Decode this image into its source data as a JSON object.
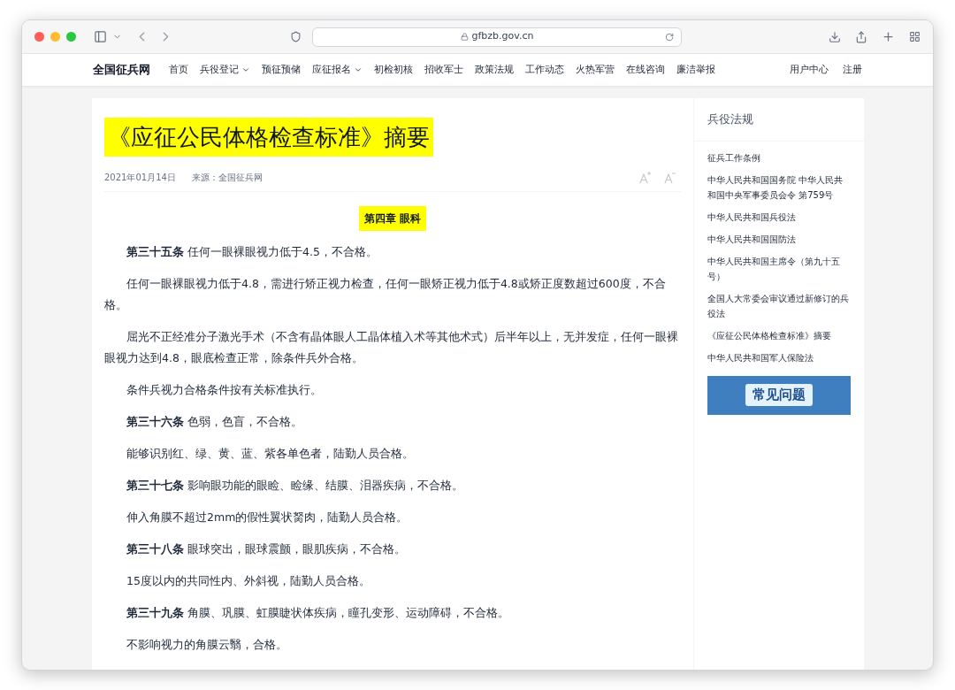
{
  "browser": {
    "url": "gfbzb.gov.cn"
  },
  "site": {
    "logo": "全国征兵网",
    "nav": [
      {
        "label": "首页",
        "dropdown": false
      },
      {
        "label": "兵役登记",
        "dropdown": true
      },
      {
        "label": "预征预储",
        "dropdown": false
      },
      {
        "label": "应征报名",
        "dropdown": true
      },
      {
        "label": "初检初核",
        "dropdown": false
      },
      {
        "label": "招收军士",
        "dropdown": false
      },
      {
        "label": "政策法规",
        "dropdown": false
      },
      {
        "label": "工作动态",
        "dropdown": false
      },
      {
        "label": "火热军营",
        "dropdown": false
      },
      {
        "label": "在线咨询",
        "dropdown": false
      },
      {
        "label": "廉洁举报",
        "dropdown": false
      }
    ],
    "user_links": [
      "用户中心",
      "注册"
    ]
  },
  "article": {
    "title": "《应征公民体格检查标准》摘要",
    "date": "2021年01月14日",
    "source": "来源：全国征兵网",
    "chapter": "第四章 眼科",
    "paragraphs": [
      "**第三十五条** 任何一眼裸眼视力低于4.5，不合格。",
      "任何一眼裸眼视力低于4.8，需进行矫正视力检查，任何一眼矫正视力低于4.8或矫正度数超过600度，不合格。",
      "屈光不正经准分子激光手术（不含有晶体眼人工晶体植入术等其他术式）后半年以上，无并发症，任何一眼裸眼视力达到4.8，眼底检查正常，除条件兵外合格。",
      "条件兵视力合格条件按有关标准执行。",
      "**第三十六条** 色弱，色盲，不合格。",
      "能够识别红、绿、黄、蓝、紫各单色者，陆勤人员合格。",
      "**第三十七条** 影响眼功能的眼睑、睑缘、结膜、泪器疾病，不合格。",
      "伸入角膜不超过2mm的假性翼状胬肉，陆勤人员合格。",
      "**第三十八条** 眼球突出，眼球震颤，眼肌疾病，不合格。",
      "15度以内的共同性内、外斜视，陆勤人员合格。",
      "**第三十九条** 角膜、巩膜、虹膜睫状体疾病，瞳孔变形、运动障碍，不合格。",
      "不影响视力的角膜云翳，合格。"
    ]
  },
  "sidebar": {
    "title": "兵役法规",
    "links": [
      "征兵工作条例",
      "中华人民共和国国务院 中华人民共和国中央军事委员会令 第759号",
      "中华人民共和国兵役法",
      "中华人民共和国国防法",
      "中华人民共和国主席令（第九十五号）",
      "全国人大常委会审议通过新修订的兵役法",
      "《应征公民体格检查标准》摘要",
      "中华人民共和国军人保险法"
    ],
    "banner": "常见问题"
  }
}
